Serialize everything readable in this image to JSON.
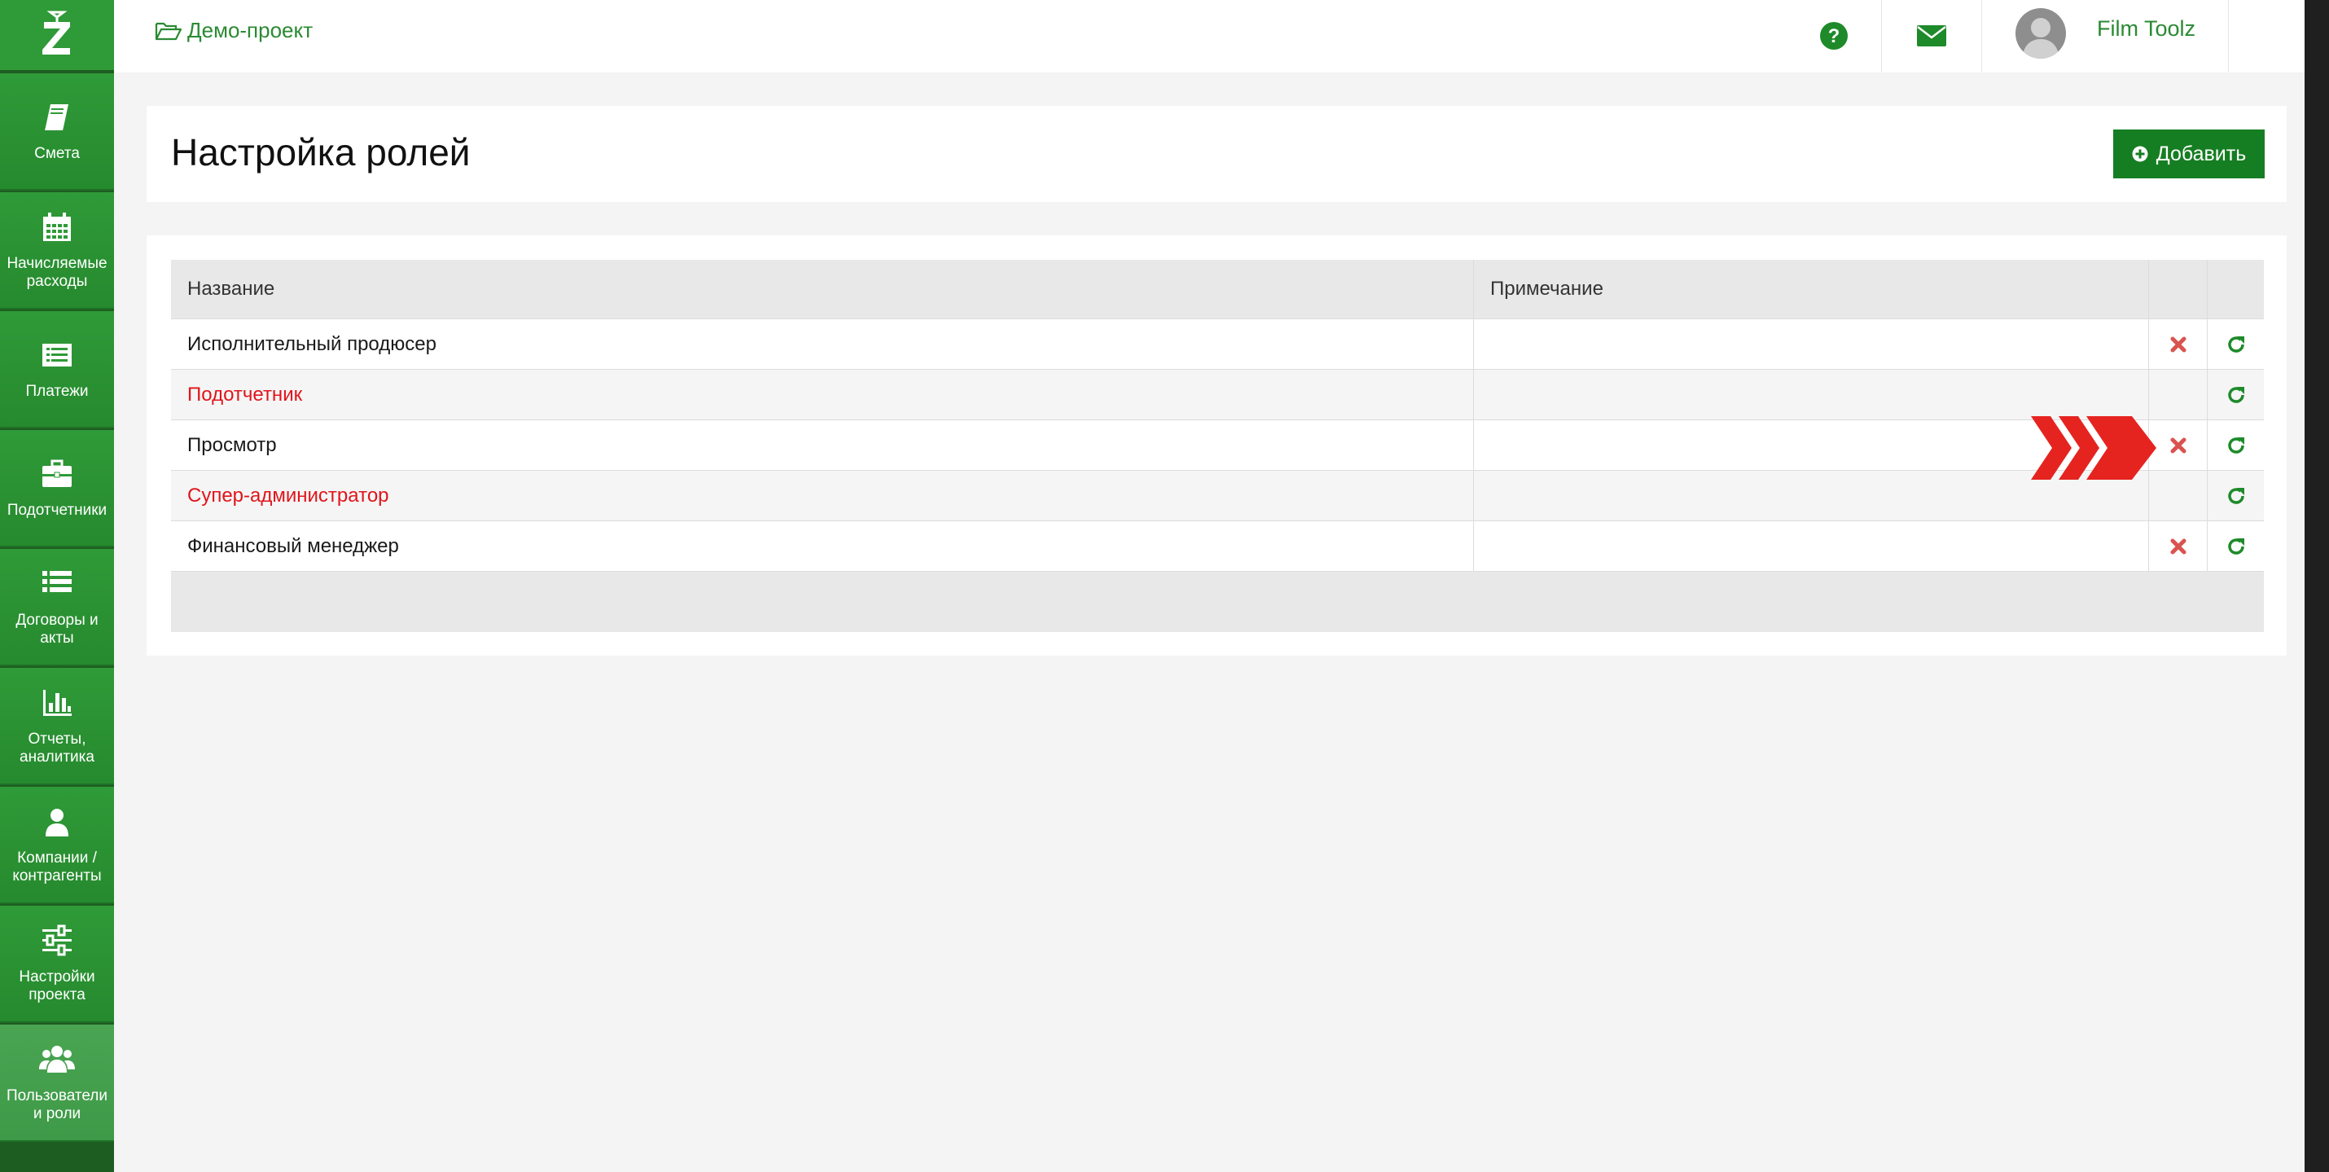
{
  "sidebar": {
    "items": [
      {
        "label": "Смета",
        "icon": "book-icon"
      },
      {
        "label": "Начисляемые расходы",
        "icon": "calendar-icon"
      },
      {
        "label": "Платежи",
        "icon": "list-box-icon"
      },
      {
        "label": "Подотчетники",
        "icon": "briefcase-icon"
      },
      {
        "label": "Договоры и акты",
        "icon": "list-icon"
      },
      {
        "label": "Отчеты, аналитика",
        "icon": "bar-chart-icon"
      },
      {
        "label": "Компании / контрагенты",
        "icon": "user-icon"
      },
      {
        "label": "Настройки проекта",
        "icon": "sliders-icon"
      },
      {
        "label": "Пользователи и роли",
        "icon": "users-icon"
      }
    ],
    "active_index": 8
  },
  "topbar": {
    "project_label": "Демо-проект",
    "user_name": "Film Toolz",
    "language": "RU"
  },
  "page": {
    "title": "Настройка ролей",
    "add_button_label": "Добавить"
  },
  "table": {
    "columns": [
      "Название",
      "Примечание",
      "",
      ""
    ],
    "rows": [
      {
        "name": "Исполнительный продюсер",
        "note": "",
        "red": false,
        "deletable": true
      },
      {
        "name": "Подотчетник",
        "note": "",
        "red": true,
        "deletable": false
      },
      {
        "name": "Просмотр",
        "note": "",
        "red": false,
        "deletable": true
      },
      {
        "name": "Супер-администратор",
        "note": "",
        "red": true,
        "deletable": false
      },
      {
        "name": "Финансовый менеджер",
        "note": "",
        "red": false,
        "deletable": true
      }
    ]
  },
  "colors": {
    "brand_green": "#2f9a38",
    "button_green": "#167e22",
    "link_green": "#2a8a33",
    "red": "#e0151b",
    "delete_red": "#d9534f",
    "chevron_red": "#e52420"
  }
}
